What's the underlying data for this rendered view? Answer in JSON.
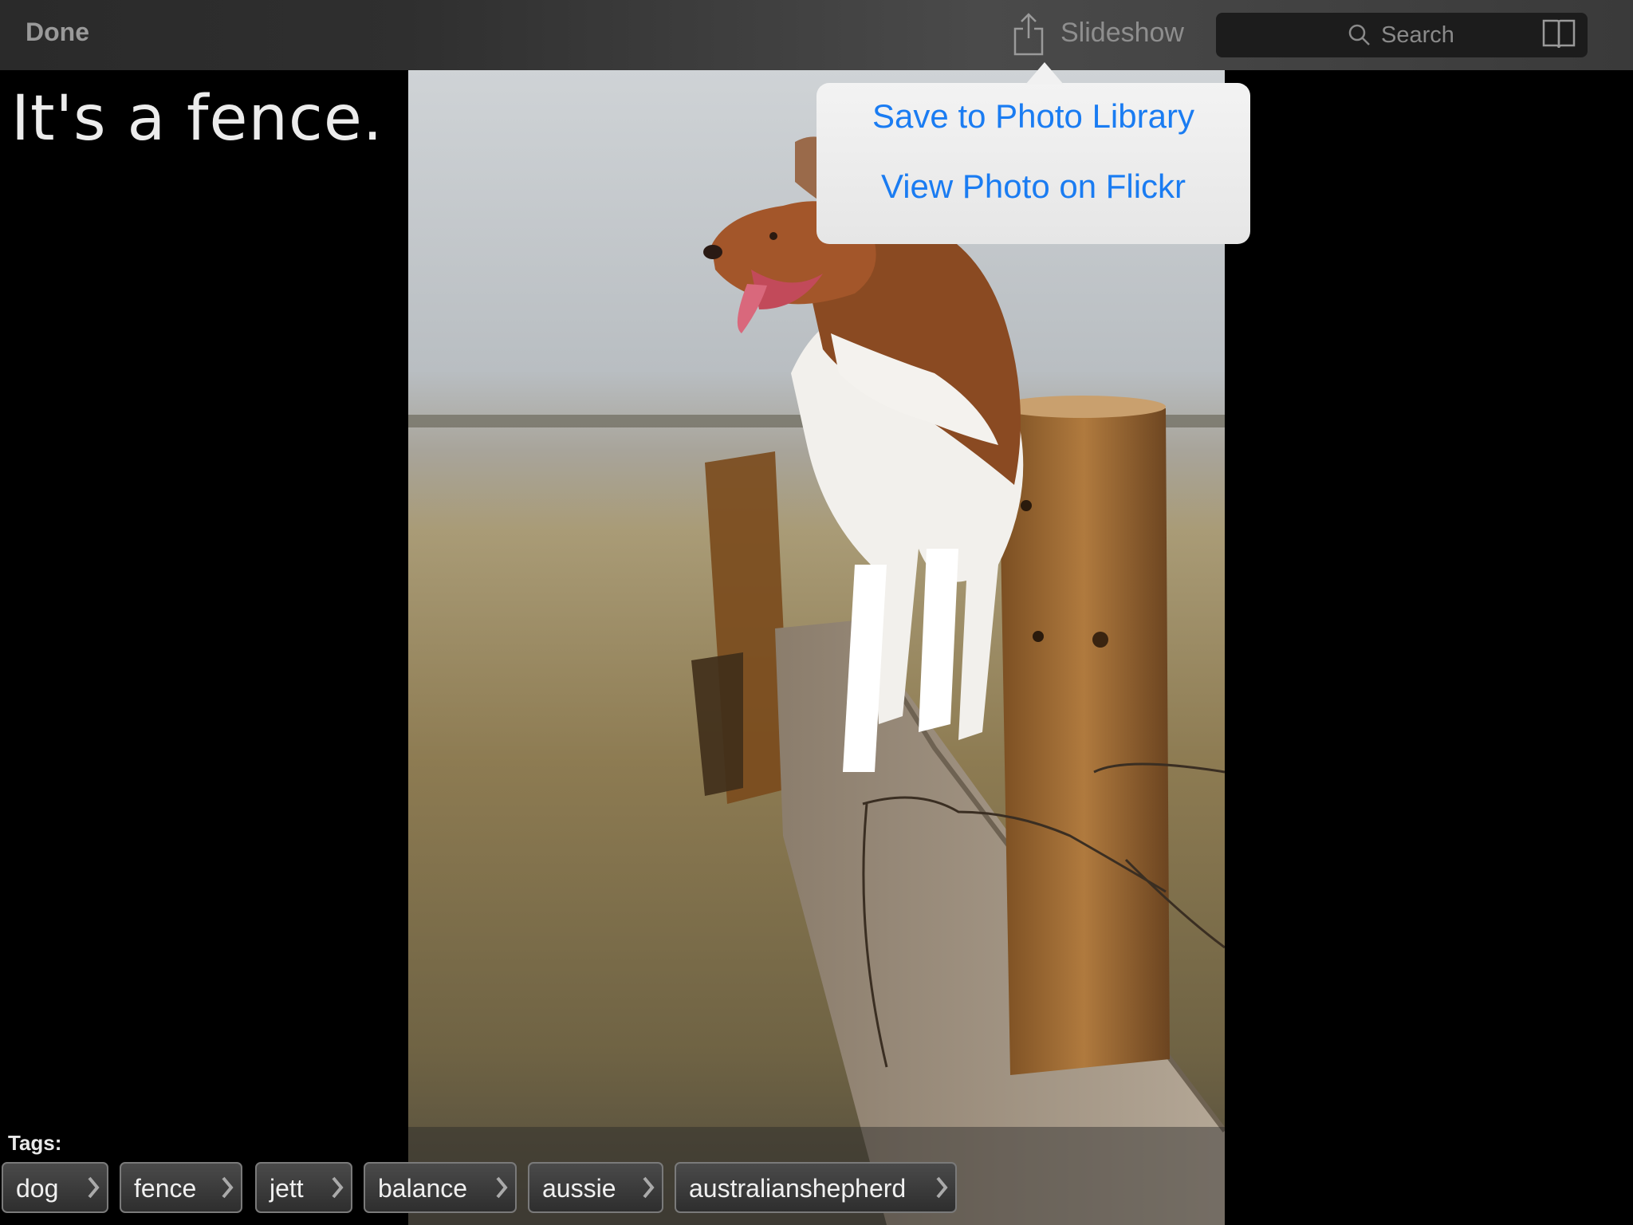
{
  "toolbar": {
    "done_label": "Done",
    "share_icon": "share-icon",
    "slideshow_label": "Slideshow",
    "search_placeholder": "Search",
    "search_icon": "search-icon",
    "book_icon": "book-icon"
  },
  "caption": "It's a fence.",
  "photo": {
    "subject": "dog-on-fence-photo"
  },
  "popover": {
    "items": [
      {
        "label": "Save to Photo Library"
      },
      {
        "label": "View Photo on Flickr"
      }
    ]
  },
  "tags": {
    "label": "Tags:",
    "items": [
      {
        "label": "dog"
      },
      {
        "label": "fence"
      },
      {
        "label": "jett"
      },
      {
        "label": "balance"
      },
      {
        "label": "aussie"
      },
      {
        "label": "australianshepherd"
      }
    ]
  },
  "colors": {
    "link_blue": "#1a7cf2",
    "toolbar_text": "#9a9a9a"
  }
}
